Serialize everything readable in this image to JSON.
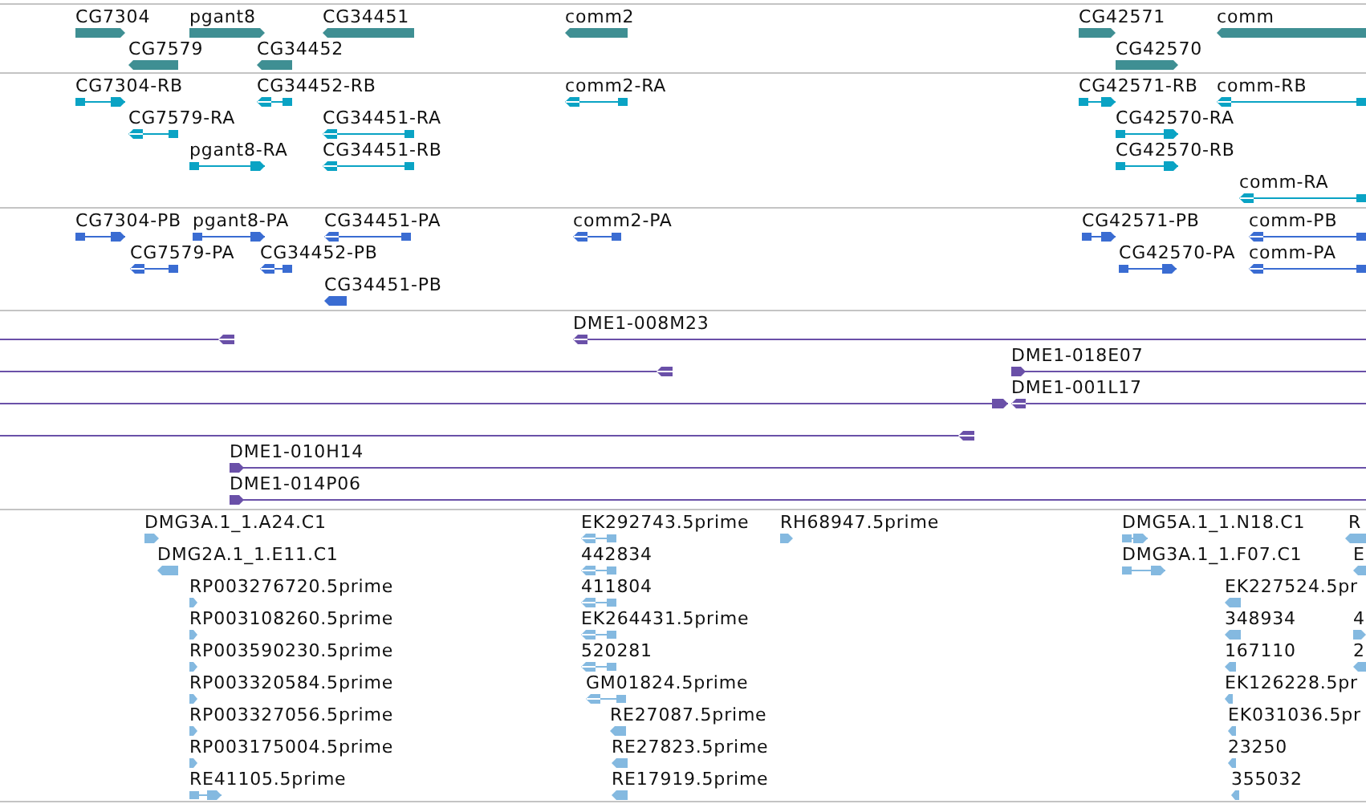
{
  "tracks": [
    {
      "kind": "gene",
      "features": [
        {
          "label": "CG7304",
          "reverse": false
        },
        {
          "label": "pgant8",
          "reverse": false
        },
        {
          "label": "CG34451",
          "reverse": true
        },
        {
          "label": "comm2",
          "reverse": true
        },
        {
          "label": "CG42571",
          "reverse": false
        },
        {
          "label": "comm",
          "reverse": true
        },
        {
          "label": "CG7579",
          "reverse": true
        },
        {
          "label": "CG34452",
          "reverse": true
        },
        {
          "label": "CG42570",
          "reverse": false
        }
      ]
    },
    {
      "kind": "transcript",
      "features": [
        {
          "label": "CG7304-RB",
          "reverse": false
        },
        {
          "label": "CG34452-RB",
          "reverse": true
        },
        {
          "label": "comm2-RA",
          "reverse": true
        },
        {
          "label": "CG42571-RB",
          "reverse": false
        },
        {
          "label": "comm-RB",
          "reverse": true
        },
        {
          "label": "CG7579-RA",
          "reverse": true
        },
        {
          "label": "CG34451-RA",
          "reverse": true
        },
        {
          "label": "CG42570-RA",
          "reverse": false
        },
        {
          "label": "pgant8-RA",
          "reverse": false
        },
        {
          "label": "CG34451-RB",
          "reverse": true
        },
        {
          "label": "CG42570-RB",
          "reverse": false
        },
        {
          "label": "comm-RA",
          "reverse": true
        }
      ]
    },
    {
      "kind": "protein",
      "features": [
        {
          "label": "CG7304-PB",
          "reverse": false
        },
        {
          "label": "pgant8-PA",
          "reverse": false
        },
        {
          "label": "CG34451-PA",
          "reverse": true
        },
        {
          "label": "comm2-PA",
          "reverse": true
        },
        {
          "label": "CG42571-PB",
          "reverse": false
        },
        {
          "label": "comm-PB",
          "reverse": true
        },
        {
          "label": "CG7579-PA",
          "reverse": true
        },
        {
          "label": "CG34452-PB",
          "reverse": true
        },
        {
          "label": "CG42570-PA",
          "reverse": false
        },
        {
          "label": "comm-PA",
          "reverse": true
        },
        {
          "label": "CG34451-PB",
          "reverse": true
        }
      ]
    },
    {
      "kind": "clone",
      "features": [
        {
          "reverse": true
        },
        {
          "label": "DME1-008M23",
          "reverse": true
        },
        {
          "reverse": true
        },
        {
          "label": "DME1-018E07",
          "reverse": false
        },
        {
          "reverse": false
        },
        {
          "label": "DME1-001L17",
          "reverse": true
        },
        {
          "reverse": true
        },
        {
          "label": "DME1-010H14",
          "reverse": false
        },
        {
          "label": "DME1-014P06",
          "reverse": false
        }
      ]
    },
    {
      "kind": "est",
      "features": [
        {
          "label": "DMG3A.1_1.A24.C1",
          "reverse": false
        },
        {
          "label": "EK292743.5prime",
          "reverse": true
        },
        {
          "label": "RH68947.5prime",
          "reverse": false
        },
        {
          "label": "DMG5A.1_1.N18.C1",
          "reverse": false
        },
        {
          "label": "R",
          "reverse": true
        },
        {
          "label": "DMG2A.1_1.E11.C1",
          "reverse": true
        },
        {
          "label": "442834",
          "reverse": true
        },
        {
          "label": "DMG3A.1_1.F07.C1",
          "reverse": false
        },
        {
          "label": "E",
          "reverse": true
        },
        {
          "label": "RP003276720.5prime",
          "reverse": false
        },
        {
          "label": "411804",
          "reverse": true
        },
        {
          "label": "EK227524.5pr",
          "reverse": true
        },
        {
          "label": "RP003108260.5prime",
          "reverse": false
        },
        {
          "label": "EK264431.5prime",
          "reverse": true
        },
        {
          "label": "348934",
          "reverse": true
        },
        {
          "label": "4",
          "reverse": false
        },
        {
          "label": "RP003590230.5prime",
          "reverse": false
        },
        {
          "label": "520281",
          "reverse": true
        },
        {
          "label": "167110",
          "reverse": true
        },
        {
          "label": "2",
          "reverse": true
        },
        {
          "label": "RP003320584.5prime",
          "reverse": false
        },
        {
          "label": "GM01824.5prime",
          "reverse": true
        },
        {
          "label": "EK126228.5pr",
          "reverse": true
        },
        {
          "label": "RP003327056.5prime",
          "reverse": false
        },
        {
          "label": "RE27087.5prime",
          "reverse": true
        },
        {
          "label": "EK031036.5pr",
          "reverse": true
        },
        {
          "label": "RP003175004.5prime",
          "reverse": false
        },
        {
          "label": "RE27823.5prime",
          "reverse": true
        },
        {
          "label": "23250",
          "reverse": true
        },
        {
          "label": "RE41105.5prime",
          "reverse": false
        },
        {
          "label": "RE17919.5prime",
          "reverse": true
        },
        {
          "label": "355032",
          "reverse": true
        }
      ]
    }
  ]
}
